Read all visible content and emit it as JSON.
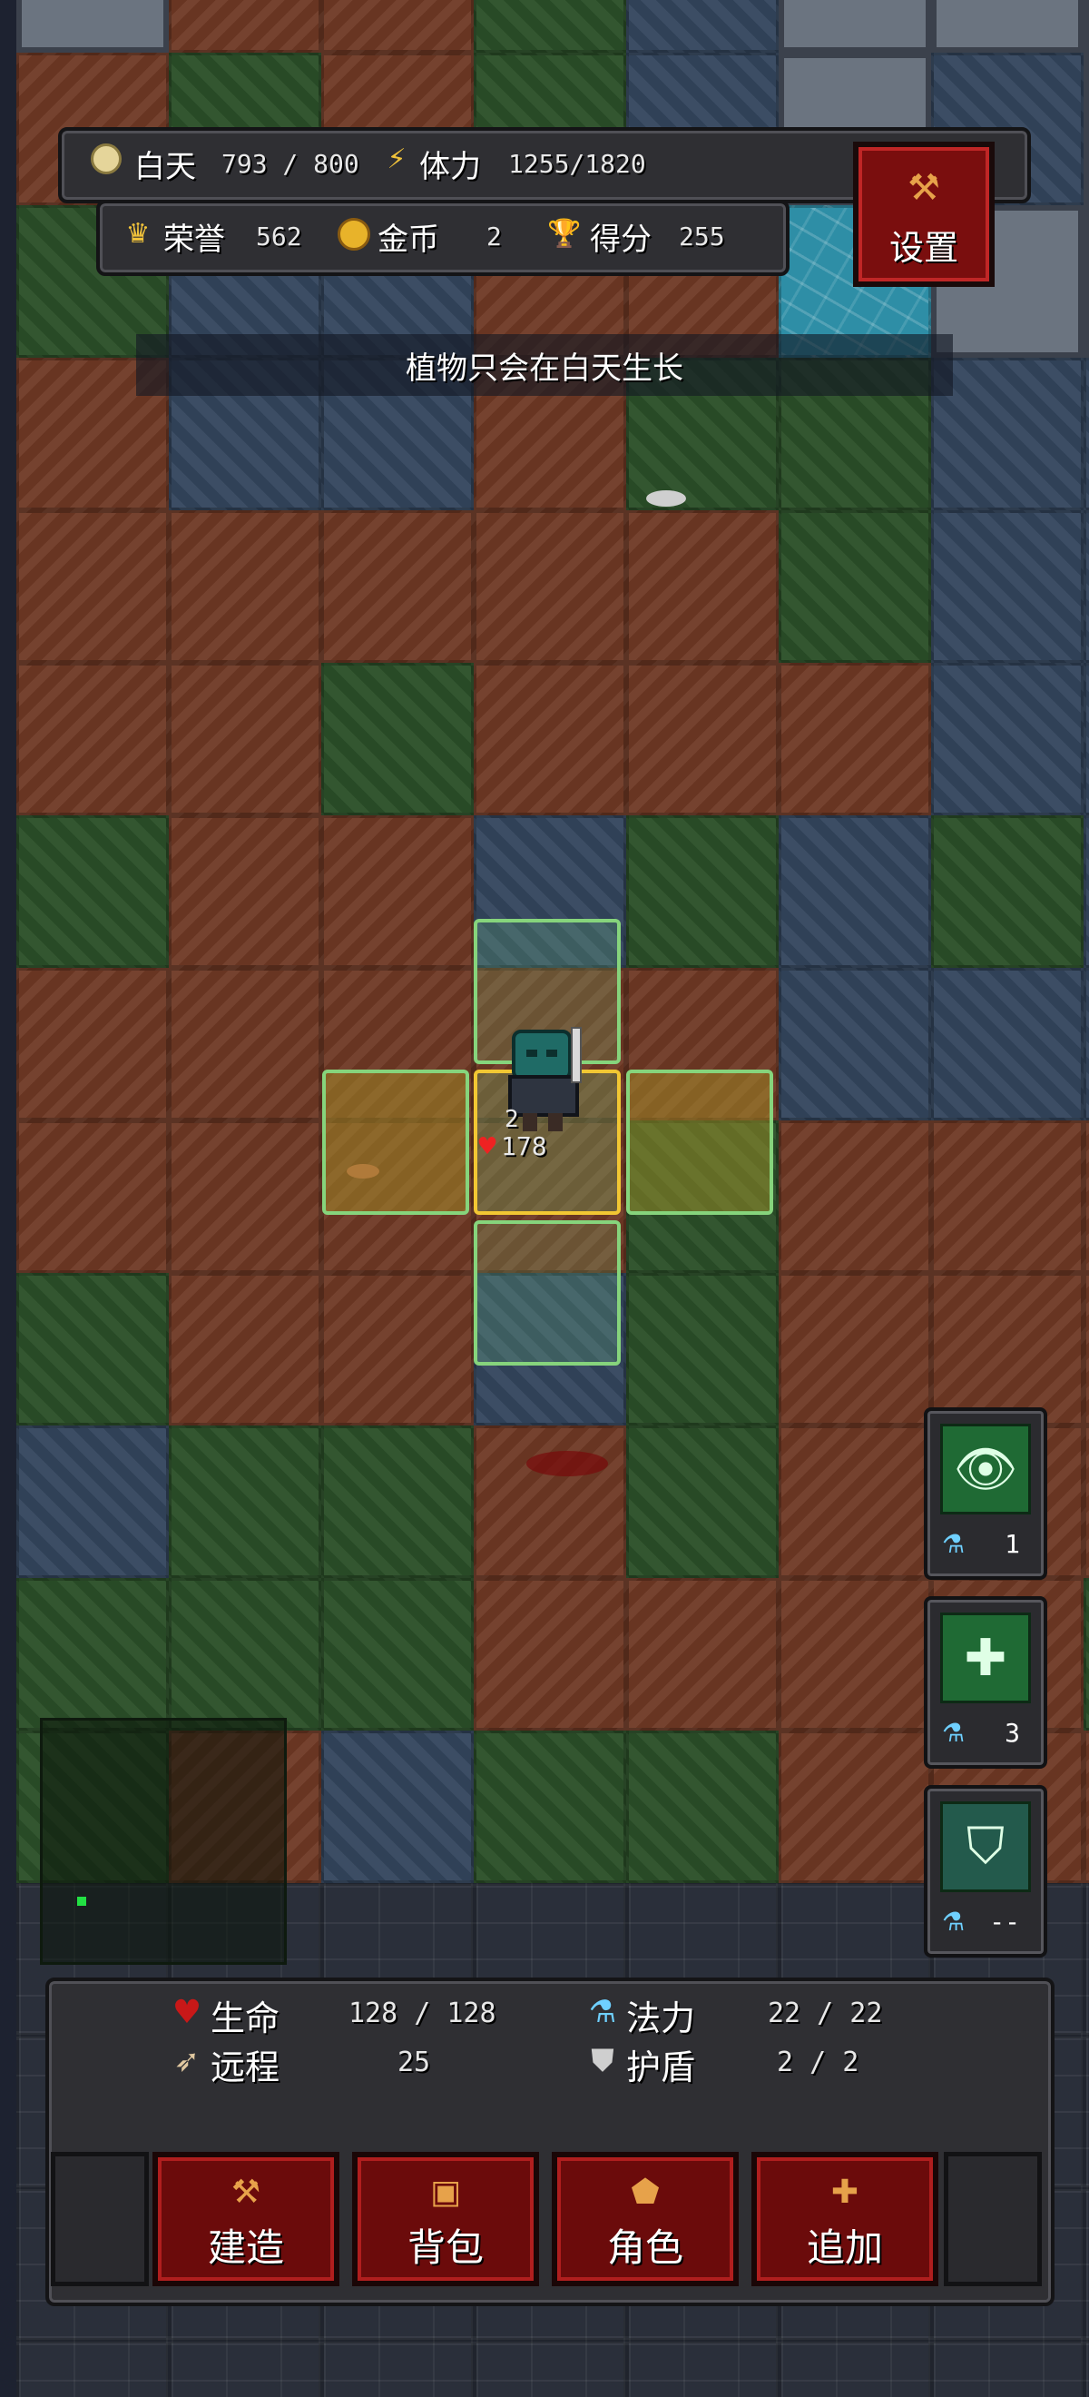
{
  "hud": {
    "day_label": "白天",
    "day_value": "793 / 800",
    "stamina_label": "体力",
    "stamina_value": "1255/1820",
    "honor_label": "荣誉",
    "honor_value": "562",
    "gold_label": "金币",
    "gold_value": "2",
    "score_label": "得分",
    "score_value": "255",
    "settings_label": "设置"
  },
  "toast": "植物只会在白天生长",
  "player": {
    "level": "2",
    "hp": "178"
  },
  "skills": [
    {
      "icon": "eye-icon",
      "cost": "1"
    },
    {
      "icon": "holy-cross-icon",
      "cost": "3"
    },
    {
      "icon": "shield-icon",
      "cost": "--"
    }
  ],
  "stats": {
    "life_label": "生命",
    "life_value": "128 / 128",
    "mana_label": "法力",
    "mana_value": "22  /  22",
    "ranged_label": "远程",
    "ranged_value": "25",
    "shield_label": "护盾",
    "shield_value": "2  /  2"
  },
  "actions": {
    "build": "建造",
    "bag": "背包",
    "character": "角色",
    "add": "追加"
  },
  "colors": {
    "dirt": "#6e3824",
    "grass": "#2b4f28",
    "stone": "#34465e",
    "button_red": "#6b0b0b",
    "highlight_green": "#86d47c",
    "selected_yellow": "#f2c733"
  }
}
